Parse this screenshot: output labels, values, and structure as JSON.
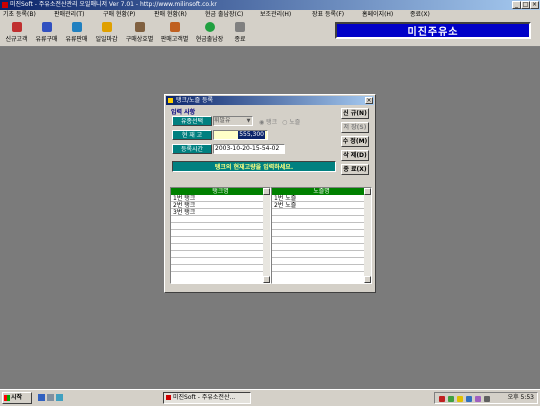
{
  "window": {
    "title": "미진Soft - 주유소전산관리 오일매니저 Ver 7.01 - http://www.milinsoft.co.kr",
    "controls": [
      "_",
      "□",
      "×"
    ]
  },
  "menu": [
    "기초 등록(B)",
    "판매관리(T)",
    "구매 현황(P)",
    "판매 현황(R)",
    "현금 출납장(C)",
    "보조관리(H)",
    "장표 등록(F)",
    "홈페이지(H)",
    "종료(X)"
  ],
  "toolbar": [
    {
      "label": "신규고객",
      "icon": "new-customer-icon",
      "color": "#c03030"
    },
    {
      "label": "유류구매",
      "icon": "fuel-purchase-icon",
      "color": "#3050c0"
    },
    {
      "label": "유류판매",
      "icon": "fuel-sale-icon",
      "color": "#2080c0"
    },
    {
      "label": "일일마감",
      "icon": "daily-close-icon",
      "color": "#e0a000"
    },
    {
      "label": "구매상호별",
      "icon": "purchase-by-company-icon",
      "color": "#806040"
    },
    {
      "label": "판매고객별",
      "icon": "sale-by-customer-icon",
      "color": "#c06020"
    },
    {
      "label": "현금출납장",
      "icon": "cashbook-icon",
      "color": "#20a040"
    },
    {
      "label": "종료",
      "icon": "exit-icon",
      "color": "#808080"
    }
  ],
  "shop_name": "미진주유소",
  "dialog": {
    "title": "탱크/노즐 등록",
    "section": "입력 사항",
    "fuel_label": "유종선택",
    "fuel_value": "휘발유",
    "radio_tank": "탱크",
    "radio_nozzle": "노즐",
    "stock_label": "현 재 고",
    "stock_value": "555,300",
    "datetime_label": "등록시간",
    "datetime_value": "2003-10-20-15-54-02",
    "message": "탱크의 현재고량을 입력하세요.",
    "buttons": [
      "신 규(N)",
      "저 장(S)",
      "수 정(M)",
      "삭 제(D)",
      "종 료(X)"
    ],
    "tank_header": "탱크명",
    "tanks": [
      "1번 탱크",
      "2번 탱크",
      "3번 탱크"
    ],
    "nozzle_header": "노즐명",
    "nozzles": [
      "1번 노즐",
      "2번 노즐"
    ]
  },
  "taskbar": {
    "start": "시작",
    "task": "미진Soft - 주유소전산...",
    "clock": "오후 5:53"
  }
}
